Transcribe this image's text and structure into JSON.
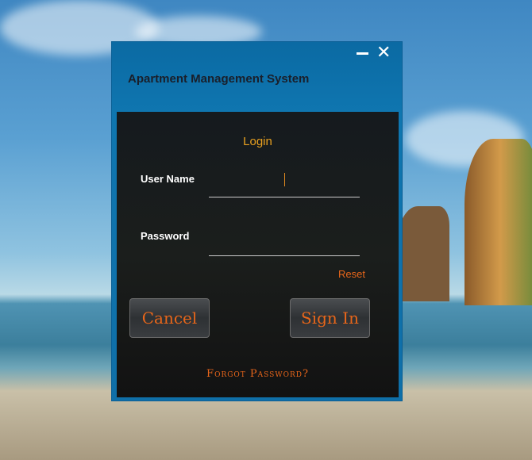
{
  "window": {
    "title": "Apartment Management System",
    "minimize_icon": "minimize-icon",
    "close_icon": "close-icon"
  },
  "form": {
    "heading": "Login",
    "username_label": "User Name",
    "username_value": "",
    "password_label": "Password",
    "password_value": "",
    "reset_label": "Reset",
    "cancel_label": "Cancel",
    "signin_label": "Sign In",
    "forgot_label": "Forgot Password?"
  }
}
